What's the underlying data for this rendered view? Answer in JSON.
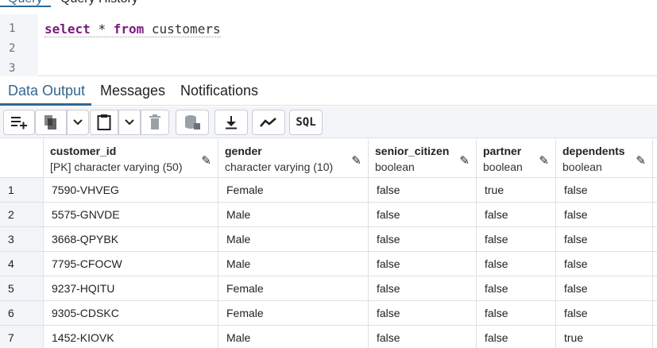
{
  "query_tabs": [
    {
      "label": "Query",
      "active": true
    },
    {
      "label": "Query History",
      "active": false
    }
  ],
  "editor": {
    "line_numbers": [
      "1",
      "2",
      "3"
    ],
    "code": {
      "kw1": "select",
      "op": "*",
      "kw2": "from",
      "ident": "customers"
    }
  },
  "output_tabs": [
    {
      "label": "Data Output",
      "active": true
    },
    {
      "label": "Messages",
      "active": false
    },
    {
      "label": "Notifications",
      "active": false
    }
  ],
  "toolbar": {
    "buttons": [
      {
        "name": "add-row-icon",
        "glyph": "≡+"
      },
      {
        "name": "copy-icon",
        "glyph": "❐"
      },
      {
        "name": "copy-options-chevron-icon",
        "glyph": "⌄"
      },
      {
        "name": "paste-icon",
        "glyph": "📋"
      },
      {
        "name": "paste-options-chevron-icon",
        "glyph": "⌄"
      },
      {
        "name": "delete-icon",
        "glyph": "🗑"
      },
      {
        "name": "save-data-icon",
        "glyph": "⛁"
      },
      {
        "name": "download-icon",
        "glyph": "⤓"
      },
      {
        "name": "graph-icon",
        "glyph": "⟋"
      },
      {
        "name": "sql-icon",
        "glyph": "SQL"
      }
    ]
  },
  "grid": {
    "columns": [
      {
        "name": "customer_id",
        "type": "[PK] character varying (50)"
      },
      {
        "name": "gender",
        "type": "character varying (10)"
      },
      {
        "name": "senior_citizen",
        "type": "boolean"
      },
      {
        "name": "partner",
        "type": "boolean"
      },
      {
        "name": "dependents",
        "type": "boolean"
      }
    ],
    "rows": [
      {
        "num": "1",
        "cells": [
          "7590-VHVEG",
          "Female",
          "false",
          "true",
          "false"
        ]
      },
      {
        "num": "2",
        "cells": [
          "5575-GNVDE",
          "Male",
          "false",
          "false",
          "false"
        ]
      },
      {
        "num": "3",
        "cells": [
          "3668-QPYBK",
          "Male",
          "false",
          "false",
          "false"
        ]
      },
      {
        "num": "4",
        "cells": [
          "7795-CFOCW",
          "Male",
          "false",
          "false",
          "false"
        ]
      },
      {
        "num": "5",
        "cells": [
          "9237-HQITU",
          "Female",
          "false",
          "false",
          "false"
        ]
      },
      {
        "num": "6",
        "cells": [
          "9305-CDSKC",
          "Female",
          "false",
          "false",
          "false"
        ]
      },
      {
        "num": "7",
        "cells": [
          "1452-KIOVK",
          "Male",
          "false",
          "false",
          "true"
        ]
      }
    ]
  },
  "colors": {
    "accent": "#326690",
    "keyword": "#7a1a7d",
    "panel_bg": "#f3f5f9",
    "border": "#dde0e6"
  }
}
